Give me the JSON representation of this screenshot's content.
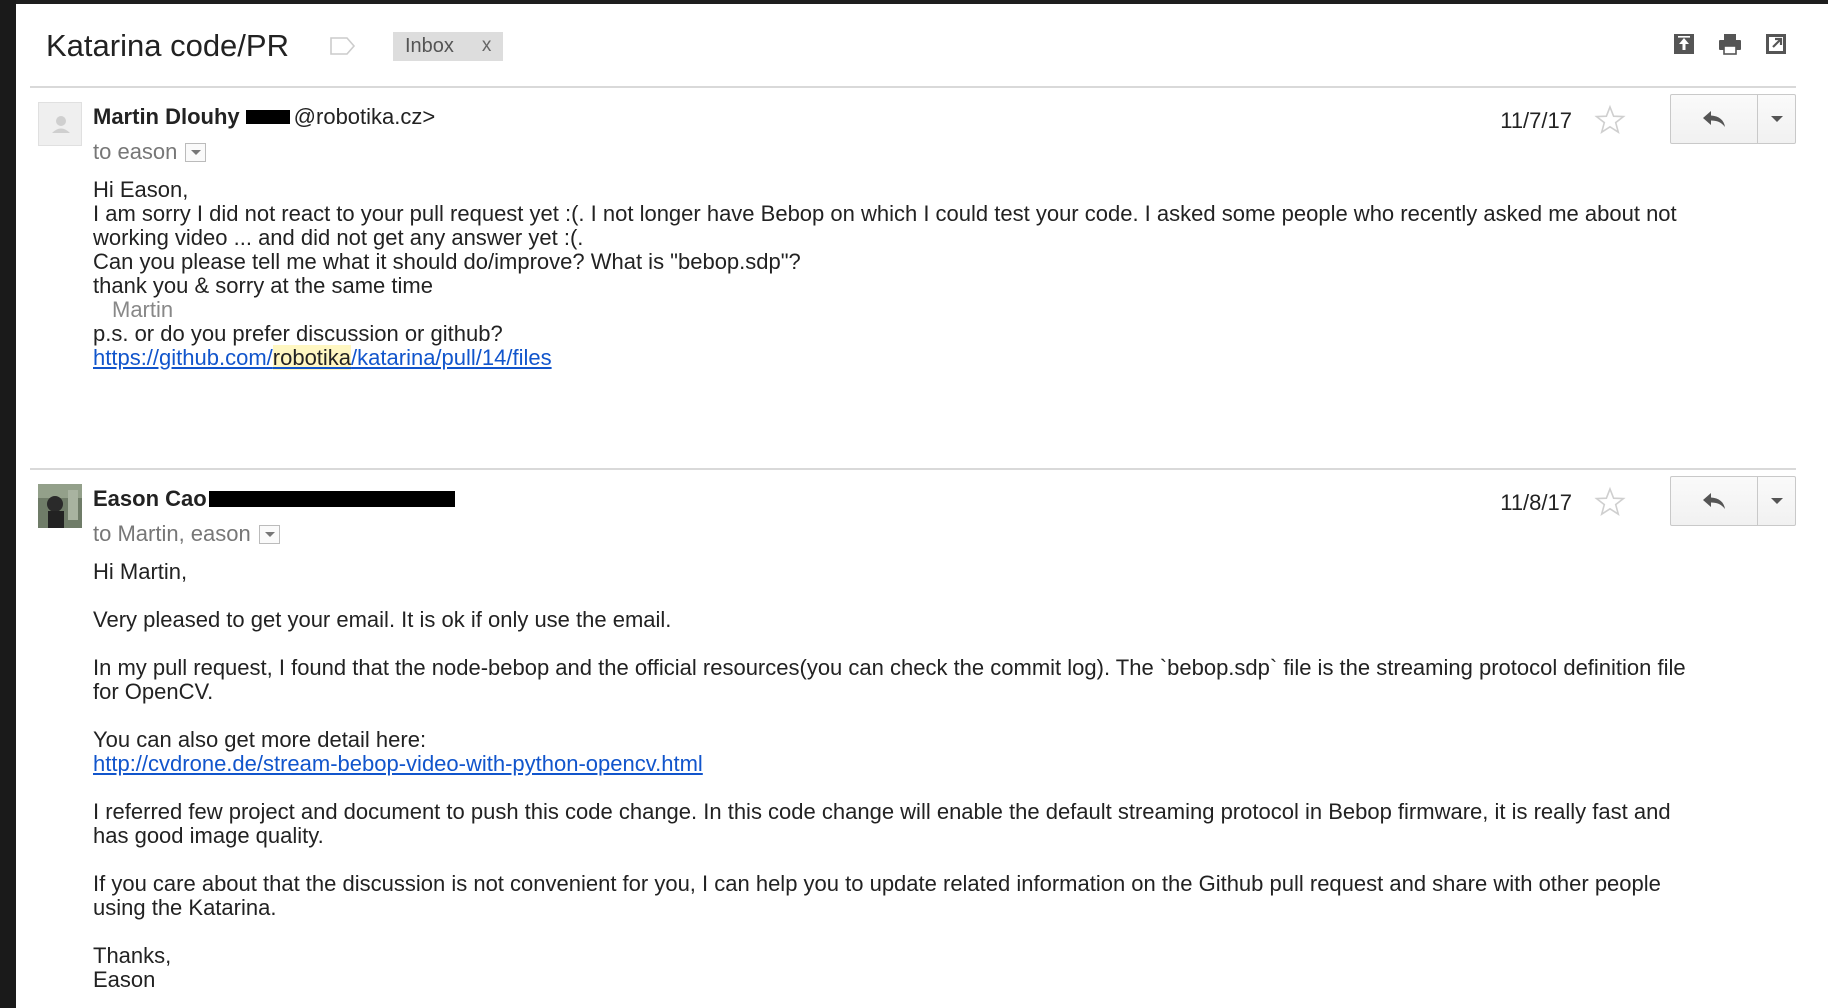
{
  "thread": {
    "subject": "Katarina code/PR",
    "label": "Inbox",
    "label_remove": "x"
  },
  "toolbar": {
    "icons": [
      "archive-icon",
      "print-icon",
      "new-window-icon"
    ]
  },
  "messages": [
    {
      "sender_name": "Martin Dlouhy",
      "sender_email_visible": "@robotika.cz>",
      "recipients": "to eason",
      "date": "11/7/17",
      "body": {
        "l1": "Hi Eason,",
        "l2": "I am sorry I did not react to your pull request yet :(. I not longer have Bebop on which I could test your code. I asked some people who recently asked me about not",
        "l3": "working video ... and did not get any answer yet :(.",
        "l4": "Can you please tell me what it should do/improve? What is \"bebop.sdp\"?",
        "l5": "thank you & sorry at the same time",
        "signature": "Martin",
        "l6": "p.s. or do you prefer discussion or github?",
        "link_pre": "https://github.com/",
        "link_hl": "robotika",
        "link_post": "/katarina/pull/14/files"
      }
    },
    {
      "sender_name": "Eason Cao",
      "recipients": "to Martin, eason",
      "date": "11/8/17",
      "body": {
        "l1": "Hi Martin,",
        "l2": "Very pleased to get your email. It is ok if only use the email.",
        "l3": "In my pull request, I found that the node-bebop and the official resources(you can check the commit log). The `bebop.sdp` file is the streaming protocol definition file",
        "l4": "for OpenCV.",
        "l5": "You can also get more detail here:",
        "link": "http://cvdrone.de/stream-bebop-video-with-python-opencv.html",
        "l6": "I referred few project and document to push this code change. In this code change will enable the default streaming protocol in Bebop firmware, it is really fast and",
        "l7": "has good image quality.",
        "l8": "If you care about that the discussion is not convenient for you,  I can help you to update related information on the Github pull request and share with other people",
        "l9": "using the Katarina.",
        "l10": "Thanks,",
        "l11": "Eason"
      }
    }
  ]
}
